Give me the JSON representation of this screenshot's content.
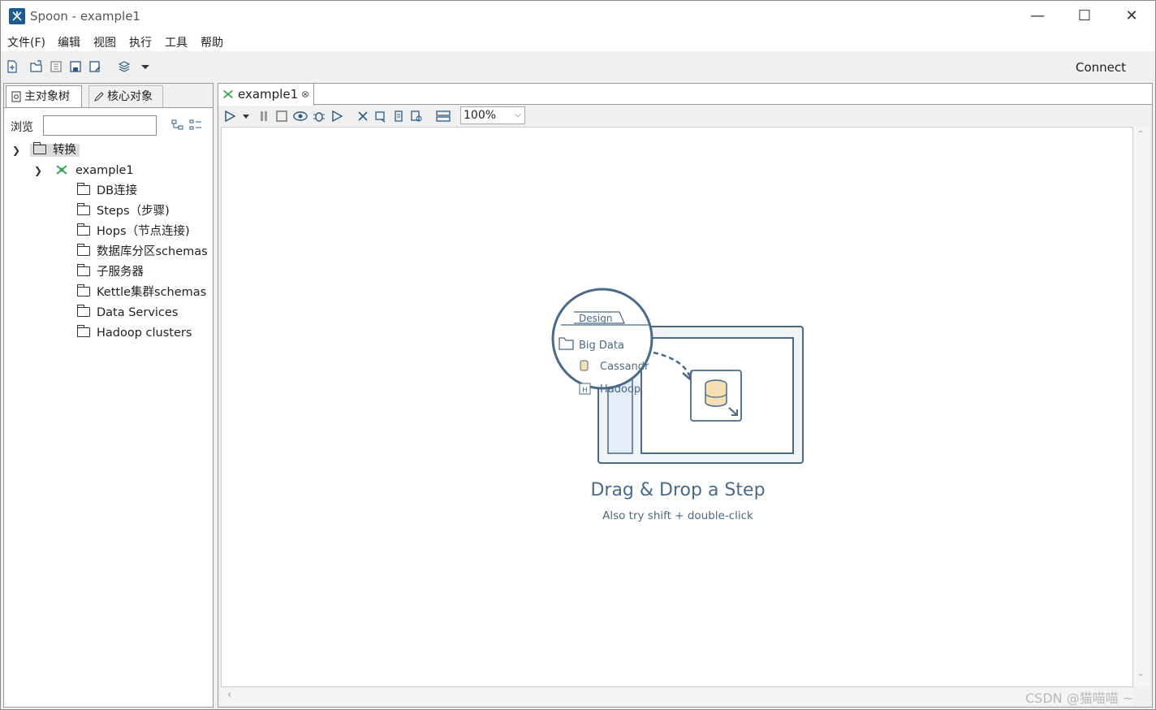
{
  "window": {
    "title": "Spoon - example1"
  },
  "menu": [
    "文件(F)",
    "编辑",
    "视图",
    "执行",
    "工具",
    "帮助"
  ],
  "toolbar": {
    "connect_label": "Connect"
  },
  "left": {
    "tabs": [
      "主对象树",
      "核心对象"
    ],
    "browse_label": "浏览",
    "tree": {
      "root": "转换",
      "transformation": "example1",
      "children": [
        "DB连接",
        "Steps（步骤)",
        "Hops（节点连接)",
        "数据库分区schemas",
        "子服务器",
        "Kettle集群schemas",
        "Data Services",
        "Hadoop clusters"
      ]
    }
  },
  "editor": {
    "tab_label": "example1",
    "zoom": "100%",
    "illustration": {
      "tab": "Design",
      "folder": "Big Data",
      "item1": "Cassandr",
      "item2": "Hadoop"
    },
    "empty_title": "Drag & Drop a Step",
    "empty_subtitle": "Also try shift + double-click"
  },
  "watermark": "CSDN @猫喵喵 ~",
  "colors": {
    "accent": "#4a6a86",
    "brand": "#1d5b8f",
    "green": "#3aa655"
  }
}
